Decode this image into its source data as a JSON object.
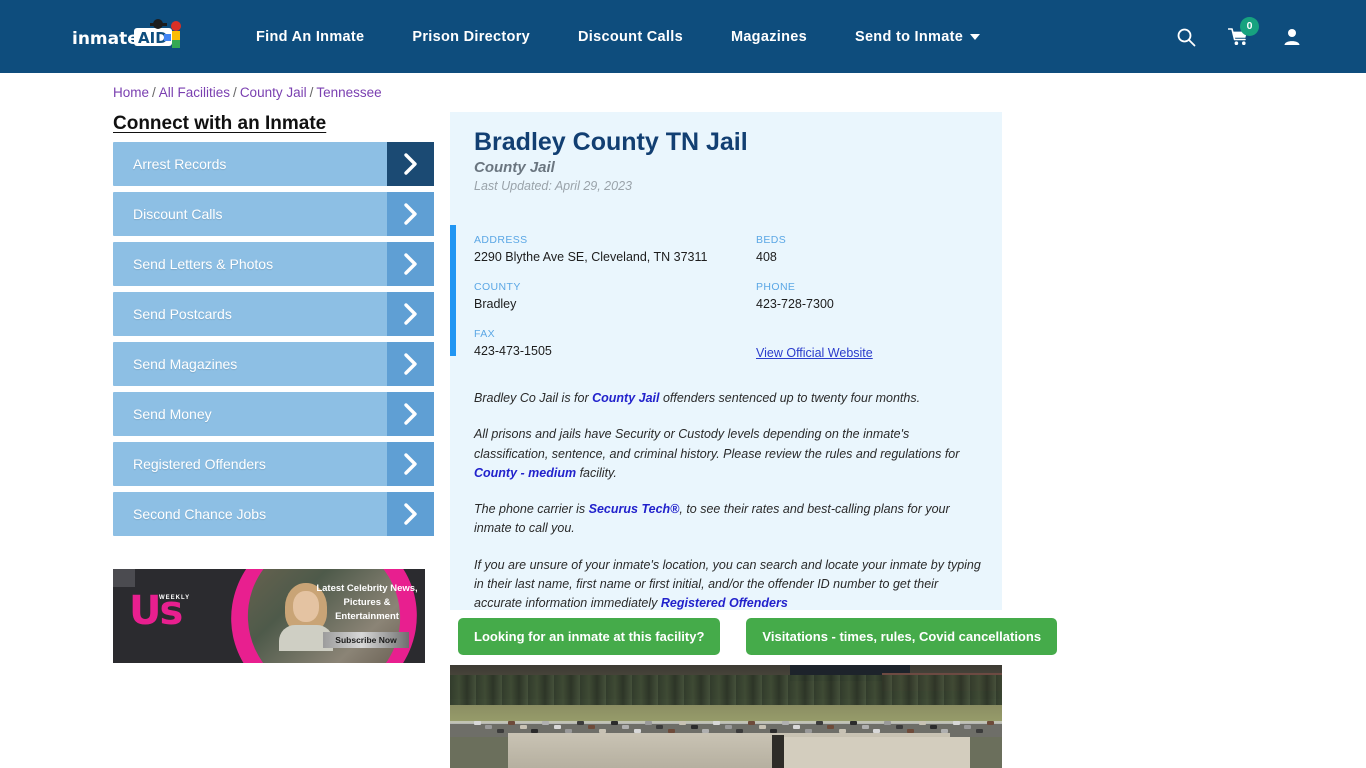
{
  "header": {
    "logo_text": "inmate",
    "logo_badge": "AID",
    "nav": [
      {
        "label": "Find An Inmate"
      },
      {
        "label": "Prison Directory"
      },
      {
        "label": "Discount Calls"
      },
      {
        "label": "Magazines"
      },
      {
        "label": "Send to Inmate",
        "has_dropdown": true
      }
    ],
    "icons": {
      "search": "search-icon",
      "cart": "cart-icon",
      "cart_count": "0",
      "account": "user-icon"
    },
    "bg_color": "#0e4d7d",
    "badge_color": "#17a27f"
  },
  "breadcrumb": {
    "items": [
      "Home",
      "All Facilities",
      "County Jail",
      "Tennessee"
    ],
    "separator": "/",
    "link_color": "#7a3fb0"
  },
  "sidebar": {
    "heading": "Connect with an Inmate",
    "items": [
      {
        "label": "Arrest Records",
        "active": true
      },
      {
        "label": "Discount Calls",
        "active": false
      },
      {
        "label": "Send Letters & Photos",
        "active": false
      },
      {
        "label": "Send Postcards",
        "active": false
      },
      {
        "label": "Send Magazines",
        "active": false
      },
      {
        "label": "Send Money",
        "active": false
      },
      {
        "label": "Registered Offenders",
        "active": false
      },
      {
        "label": "Second Chance Jobs",
        "active": false
      }
    ],
    "button_color": "#8dbfe4",
    "chevron_color": "#5f9fd4",
    "chevron_active_color": "#1b4a73"
  },
  "ad": {
    "brand": "Us",
    "brand_mark": "WEEKLY",
    "headline": "Latest Celebrity News, Pictures & Entertainment",
    "cta": "Subscribe Now",
    "accent_color": "#e81f8f"
  },
  "facility": {
    "title": "Bradley County TN Jail",
    "subtitle": "County Jail",
    "last_updated": "Last Updated: April 29, 2023",
    "details": [
      {
        "label": "ADDRESS",
        "value": "2290 Blythe Ave SE, Cleveland, TN 37311"
      },
      {
        "label": "BEDS",
        "value": "408"
      },
      {
        "label": "COUNTY",
        "value": "Bradley"
      },
      {
        "label": "PHONE",
        "value": "423-728-7300"
      },
      {
        "label": "FAX",
        "value": "423-473-1505"
      }
    ],
    "official_website_link": "View Official Website",
    "accent_bar_color": "#2196f3",
    "panel_bg": "#eaf6fd"
  },
  "description": {
    "p1_a": "Bradley Co Jail is for ",
    "p1_link": "County Jail",
    "p1_b": " offenders sentenced up to twenty four months.",
    "p2_a": "All prisons and jails have Security or Custody levels depending on the inmate's classification, sentence, and criminal history. Please review the rules and regulations for ",
    "p2_link": "County - medium",
    "p2_b": " facility.",
    "p3_a": "The phone carrier is ",
    "p3_link": "Securus Tech®",
    "p3_b": ", to see their rates and best-calling plans for your inmate to call you.",
    "p4_a": "If you are unsure of your inmate's location, you can search and locate your inmate by typing in their last name, first name or first initial, and/or the offender ID number to get their accurate information immediately ",
    "p4_link": "Registered Offenders"
  },
  "actions": {
    "find_inmate": "Looking for an inmate at this facility?",
    "visitations": "Visitations - times, rules, Covid cancellations",
    "color": "#45ab4a"
  },
  "aerial": {
    "alt": "Aerial satellite view of Bradley County TN Jail facility"
  }
}
